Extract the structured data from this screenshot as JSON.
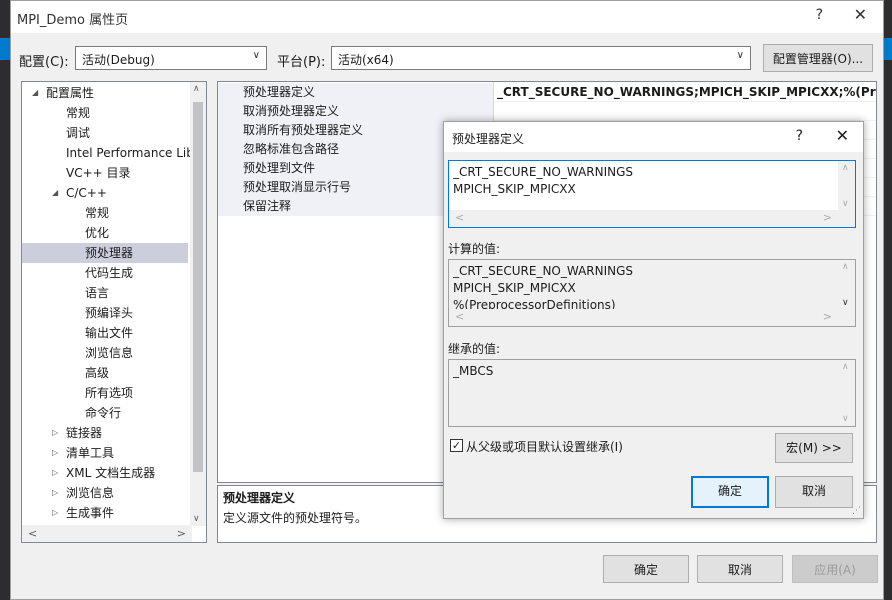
{
  "window": {
    "title": "MPI_Demo 属性页",
    "help": "?",
    "close": "✕"
  },
  "config": {
    "config_label": "配置(C):",
    "config_value": "活动(Debug)",
    "platform_label": "平台(P):",
    "platform_value": "活动(x64)",
    "manager_button": "配置管理器(O)..."
  },
  "tree": {
    "items": [
      {
        "label": "配置属性",
        "caret": "◢",
        "level": 0
      },
      {
        "label": "常规",
        "caret": "",
        "level": 1
      },
      {
        "label": "调试",
        "caret": "",
        "level": 1
      },
      {
        "label": "Intel Performance Lib",
        "caret": "",
        "level": 1
      },
      {
        "label": "VC++ 目录",
        "caret": "",
        "level": 1
      },
      {
        "label": "C/C++",
        "caret": "◢",
        "level": 1
      },
      {
        "label": "常规",
        "caret": "",
        "level": 2
      },
      {
        "label": "优化",
        "caret": "",
        "level": 2
      },
      {
        "label": "预处理器",
        "caret": "",
        "level": 2,
        "selected": true
      },
      {
        "label": "代码生成",
        "caret": "",
        "level": 2
      },
      {
        "label": "语言",
        "caret": "",
        "level": 2
      },
      {
        "label": "预编译头",
        "caret": "",
        "level": 2
      },
      {
        "label": "输出文件",
        "caret": "",
        "level": 2
      },
      {
        "label": "浏览信息",
        "caret": "",
        "level": 2
      },
      {
        "label": "高级",
        "caret": "",
        "level": 2
      },
      {
        "label": "所有选项",
        "caret": "",
        "level": 2
      },
      {
        "label": "命令行",
        "caret": "",
        "level": 2
      },
      {
        "label": "链接器",
        "caret": "▷",
        "level": 1
      },
      {
        "label": "清单工具",
        "caret": "▷",
        "level": 1
      },
      {
        "label": "XML 文档生成器",
        "caret": "▷",
        "level": 1
      },
      {
        "label": "浏览信息",
        "caret": "▷",
        "level": 1
      },
      {
        "label": "生成事件",
        "caret": "▷",
        "level": 1
      }
    ]
  },
  "grid": {
    "rows": [
      {
        "name": "预处理器定义",
        "value": "_CRT_SECURE_NO_WARNINGS;MPICH_SKIP_MPICXX;%(PreprocessorDefinitions)"
      },
      {
        "name": "取消预处理器定义",
        "value": ""
      },
      {
        "name": "取消所有预处理器定义",
        "value": ""
      },
      {
        "name": "忽略标准包含路径",
        "value": ""
      },
      {
        "name": "预处理到文件",
        "value": ""
      },
      {
        "name": "预处理取消显示行号",
        "value": ""
      },
      {
        "name": "保留注释",
        "value": ""
      }
    ]
  },
  "description": {
    "title": "预处理器定义",
    "text": "定义源文件的预处理符号。"
  },
  "footer": {
    "ok": "确定",
    "cancel": "取消",
    "apply": "应用(A)"
  },
  "dialog": {
    "title": "预处理器定义",
    "help": "?",
    "close": "✕",
    "edit_lines": [
      "_CRT_SECURE_NO_WARNINGS",
      "MPICH_SKIP_MPICXX"
    ],
    "computed_label": "计算的值:",
    "computed_lines": [
      "_CRT_SECURE_NO_WARNINGS",
      "MPICH_SKIP_MPICXX",
      "%(PreprocessorDefinitions)"
    ],
    "inherited_label": "继承的值:",
    "inherited_lines": [
      "_MBCS"
    ],
    "inherit_checkbox": "从父级或项目默认设置继承(I)",
    "inherit_checked": true,
    "macro_button": "宏(M) >>",
    "ok": "确定",
    "cancel": "取消"
  },
  "colors": {
    "accent": "#0078d7",
    "selection": "#cccedb",
    "ide_dark": "#1e1e1e"
  }
}
